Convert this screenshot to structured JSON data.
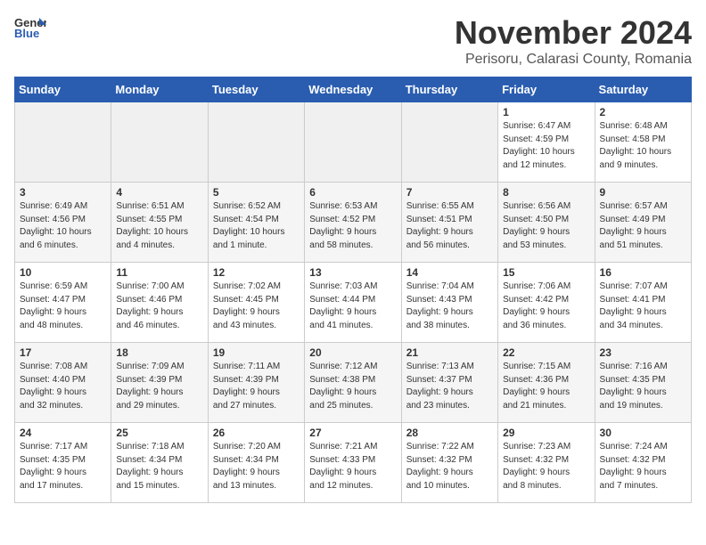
{
  "header": {
    "logo_general": "General",
    "logo_blue": "Blue",
    "month_title": "November 2024",
    "location": "Perisoru, Calarasi County, Romania"
  },
  "weekdays": [
    "Sunday",
    "Monday",
    "Tuesday",
    "Wednesday",
    "Thursday",
    "Friday",
    "Saturday"
  ],
  "weeks": [
    [
      {
        "day": "",
        "info": ""
      },
      {
        "day": "",
        "info": ""
      },
      {
        "day": "",
        "info": ""
      },
      {
        "day": "",
        "info": ""
      },
      {
        "day": "",
        "info": ""
      },
      {
        "day": "1",
        "info": "Sunrise: 6:47 AM\nSunset: 4:59 PM\nDaylight: 10 hours\nand 12 minutes."
      },
      {
        "day": "2",
        "info": "Sunrise: 6:48 AM\nSunset: 4:58 PM\nDaylight: 10 hours\nand 9 minutes."
      }
    ],
    [
      {
        "day": "3",
        "info": "Sunrise: 6:49 AM\nSunset: 4:56 PM\nDaylight: 10 hours\nand 6 minutes."
      },
      {
        "day": "4",
        "info": "Sunrise: 6:51 AM\nSunset: 4:55 PM\nDaylight: 10 hours\nand 4 minutes."
      },
      {
        "day": "5",
        "info": "Sunrise: 6:52 AM\nSunset: 4:54 PM\nDaylight: 10 hours\nand 1 minute."
      },
      {
        "day": "6",
        "info": "Sunrise: 6:53 AM\nSunset: 4:52 PM\nDaylight: 9 hours\nand 58 minutes."
      },
      {
        "day": "7",
        "info": "Sunrise: 6:55 AM\nSunset: 4:51 PM\nDaylight: 9 hours\nand 56 minutes."
      },
      {
        "day": "8",
        "info": "Sunrise: 6:56 AM\nSunset: 4:50 PM\nDaylight: 9 hours\nand 53 minutes."
      },
      {
        "day": "9",
        "info": "Sunrise: 6:57 AM\nSunset: 4:49 PM\nDaylight: 9 hours\nand 51 minutes."
      }
    ],
    [
      {
        "day": "10",
        "info": "Sunrise: 6:59 AM\nSunset: 4:47 PM\nDaylight: 9 hours\nand 48 minutes."
      },
      {
        "day": "11",
        "info": "Sunrise: 7:00 AM\nSunset: 4:46 PM\nDaylight: 9 hours\nand 46 minutes."
      },
      {
        "day": "12",
        "info": "Sunrise: 7:02 AM\nSunset: 4:45 PM\nDaylight: 9 hours\nand 43 minutes."
      },
      {
        "day": "13",
        "info": "Sunrise: 7:03 AM\nSunset: 4:44 PM\nDaylight: 9 hours\nand 41 minutes."
      },
      {
        "day": "14",
        "info": "Sunrise: 7:04 AM\nSunset: 4:43 PM\nDaylight: 9 hours\nand 38 minutes."
      },
      {
        "day": "15",
        "info": "Sunrise: 7:06 AM\nSunset: 4:42 PM\nDaylight: 9 hours\nand 36 minutes."
      },
      {
        "day": "16",
        "info": "Sunrise: 7:07 AM\nSunset: 4:41 PM\nDaylight: 9 hours\nand 34 minutes."
      }
    ],
    [
      {
        "day": "17",
        "info": "Sunrise: 7:08 AM\nSunset: 4:40 PM\nDaylight: 9 hours\nand 32 minutes."
      },
      {
        "day": "18",
        "info": "Sunrise: 7:09 AM\nSunset: 4:39 PM\nDaylight: 9 hours\nand 29 minutes."
      },
      {
        "day": "19",
        "info": "Sunrise: 7:11 AM\nSunset: 4:39 PM\nDaylight: 9 hours\nand 27 minutes."
      },
      {
        "day": "20",
        "info": "Sunrise: 7:12 AM\nSunset: 4:38 PM\nDaylight: 9 hours\nand 25 minutes."
      },
      {
        "day": "21",
        "info": "Sunrise: 7:13 AM\nSunset: 4:37 PM\nDaylight: 9 hours\nand 23 minutes."
      },
      {
        "day": "22",
        "info": "Sunrise: 7:15 AM\nSunset: 4:36 PM\nDaylight: 9 hours\nand 21 minutes."
      },
      {
        "day": "23",
        "info": "Sunrise: 7:16 AM\nSunset: 4:35 PM\nDaylight: 9 hours\nand 19 minutes."
      }
    ],
    [
      {
        "day": "24",
        "info": "Sunrise: 7:17 AM\nSunset: 4:35 PM\nDaylight: 9 hours\nand 17 minutes."
      },
      {
        "day": "25",
        "info": "Sunrise: 7:18 AM\nSunset: 4:34 PM\nDaylight: 9 hours\nand 15 minutes."
      },
      {
        "day": "26",
        "info": "Sunrise: 7:20 AM\nSunset: 4:34 PM\nDaylight: 9 hours\nand 13 minutes."
      },
      {
        "day": "27",
        "info": "Sunrise: 7:21 AM\nSunset: 4:33 PM\nDaylight: 9 hours\nand 12 minutes."
      },
      {
        "day": "28",
        "info": "Sunrise: 7:22 AM\nSunset: 4:32 PM\nDaylight: 9 hours\nand 10 minutes."
      },
      {
        "day": "29",
        "info": "Sunrise: 7:23 AM\nSunset: 4:32 PM\nDaylight: 9 hours\nand 8 minutes."
      },
      {
        "day": "30",
        "info": "Sunrise: 7:24 AM\nSunset: 4:32 PM\nDaylight: 9 hours\nand 7 minutes."
      }
    ]
  ]
}
